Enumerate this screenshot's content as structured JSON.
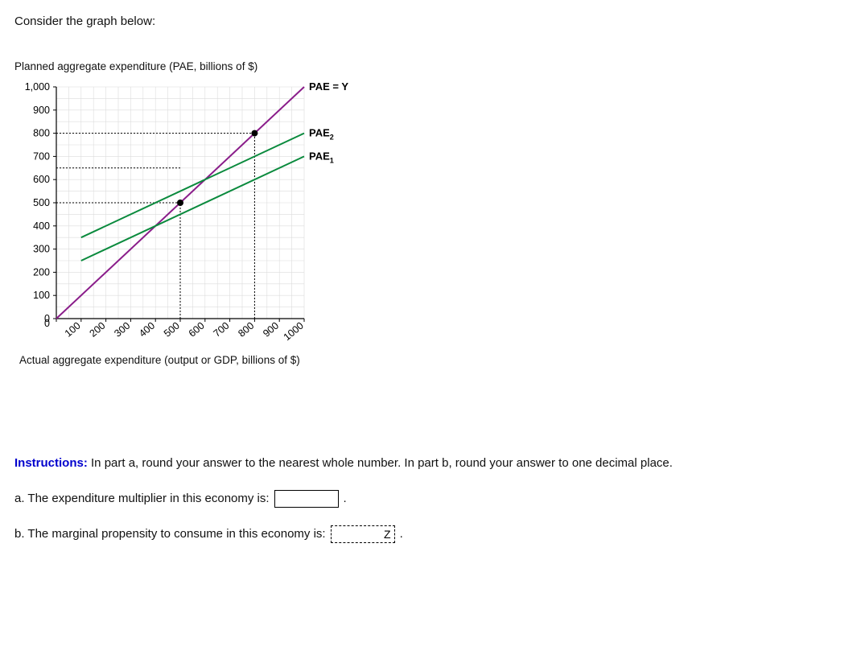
{
  "title": "Consider the graph below:",
  "y_axis_title": "Planned aggregate expenditure (PAE, billions of $)",
  "x_axis_title": "Actual aggregate expenditure (output or GDP, billions of $)",
  "instructions_label": "Instructions:",
  "instructions_text": " In part a, round your answer to the nearest whole number. In part b, round your answer to one decimal place.",
  "question_a": "a. The expenditure multiplier in this economy is:",
  "question_b": "b. The marginal propensity to consume in this economy is:",
  "input_b_value": "Z",
  "period_a": ".",
  "period_b": ".",
  "chart_data": {
    "type": "line",
    "xlabel": "Actual aggregate expenditure (output or GDP, billions of $)",
    "ylabel": "Planned aggregate expenditure (PAE, billions of $)",
    "xlim": [
      0,
      1000
    ],
    "ylim": [
      0,
      1000
    ],
    "x_ticks": [
      0,
      100,
      200,
      300,
      400,
      500,
      600,
      700,
      800,
      900,
      1000
    ],
    "y_ticks": [
      0,
      100,
      200,
      300,
      400,
      500,
      600,
      700,
      800,
      900,
      1000
    ],
    "grid": true,
    "series": [
      {
        "name": "PAE = Y",
        "color": "#8a1d8a",
        "x": [
          0,
          1000
        ],
        "y": [
          0,
          1000
        ]
      },
      {
        "name": "PAE2",
        "color": "#0a8a3d",
        "x": [
          100,
          1000
        ],
        "y": [
          350,
          800
        ]
      },
      {
        "name": "PAE1",
        "color": "#0a8a3d",
        "x": [
          100,
          1000
        ],
        "y": [
          250,
          700
        ]
      }
    ],
    "points": [
      {
        "x": 500,
        "y": 500,
        "color": "#000"
      },
      {
        "x": 800,
        "y": 800,
        "color": "#000"
      }
    ],
    "guides": [
      {
        "type": "h",
        "y": 500,
        "x1": 0,
        "x2": 500
      },
      {
        "type": "v",
        "x": 500,
        "y1": 0,
        "y2": 500
      },
      {
        "type": "h",
        "y": 650,
        "x1": 0,
        "x2": 500
      },
      {
        "type": "h",
        "y": 800,
        "x1": 0,
        "x2": 800
      },
      {
        "type": "v",
        "x": 800,
        "y1": 0,
        "y2": 800
      }
    ],
    "labels": {
      "line45": "PAE = Y",
      "pae2": "PAE",
      "pae2_sub": "2",
      "pae1": "PAE",
      "pae1_sub": "1"
    }
  }
}
